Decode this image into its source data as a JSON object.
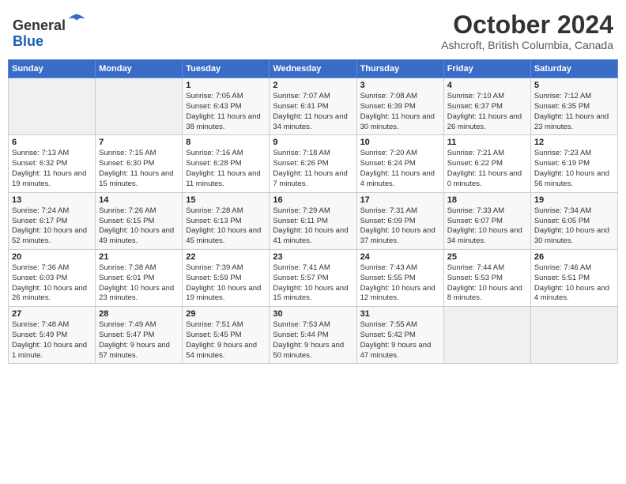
{
  "header": {
    "logo_line1": "General",
    "logo_line2": "Blue",
    "month": "October 2024",
    "location": "Ashcroft, British Columbia, Canada"
  },
  "weekdays": [
    "Sunday",
    "Monday",
    "Tuesday",
    "Wednesday",
    "Thursday",
    "Friday",
    "Saturday"
  ],
  "weeks": [
    [
      {
        "day": "",
        "sunrise": "",
        "sunset": "",
        "daylight": ""
      },
      {
        "day": "",
        "sunrise": "",
        "sunset": "",
        "daylight": ""
      },
      {
        "day": "1",
        "sunrise": "Sunrise: 7:05 AM",
        "sunset": "Sunset: 6:43 PM",
        "daylight": "Daylight: 11 hours and 38 minutes."
      },
      {
        "day": "2",
        "sunrise": "Sunrise: 7:07 AM",
        "sunset": "Sunset: 6:41 PM",
        "daylight": "Daylight: 11 hours and 34 minutes."
      },
      {
        "day": "3",
        "sunrise": "Sunrise: 7:08 AM",
        "sunset": "Sunset: 6:39 PM",
        "daylight": "Daylight: 11 hours and 30 minutes."
      },
      {
        "day": "4",
        "sunrise": "Sunrise: 7:10 AM",
        "sunset": "Sunset: 6:37 PM",
        "daylight": "Daylight: 11 hours and 26 minutes."
      },
      {
        "day": "5",
        "sunrise": "Sunrise: 7:12 AM",
        "sunset": "Sunset: 6:35 PM",
        "daylight": "Daylight: 11 hours and 23 minutes."
      }
    ],
    [
      {
        "day": "6",
        "sunrise": "Sunrise: 7:13 AM",
        "sunset": "Sunset: 6:32 PM",
        "daylight": "Daylight: 11 hours and 19 minutes."
      },
      {
        "day": "7",
        "sunrise": "Sunrise: 7:15 AM",
        "sunset": "Sunset: 6:30 PM",
        "daylight": "Daylight: 11 hours and 15 minutes."
      },
      {
        "day": "8",
        "sunrise": "Sunrise: 7:16 AM",
        "sunset": "Sunset: 6:28 PM",
        "daylight": "Daylight: 11 hours and 11 minutes."
      },
      {
        "day": "9",
        "sunrise": "Sunrise: 7:18 AM",
        "sunset": "Sunset: 6:26 PM",
        "daylight": "Daylight: 11 hours and 7 minutes."
      },
      {
        "day": "10",
        "sunrise": "Sunrise: 7:20 AM",
        "sunset": "Sunset: 6:24 PM",
        "daylight": "Daylight: 11 hours and 4 minutes."
      },
      {
        "day": "11",
        "sunrise": "Sunrise: 7:21 AM",
        "sunset": "Sunset: 6:22 PM",
        "daylight": "Daylight: 11 hours and 0 minutes."
      },
      {
        "day": "12",
        "sunrise": "Sunrise: 7:23 AM",
        "sunset": "Sunset: 6:19 PM",
        "daylight": "Daylight: 10 hours and 56 minutes."
      }
    ],
    [
      {
        "day": "13",
        "sunrise": "Sunrise: 7:24 AM",
        "sunset": "Sunset: 6:17 PM",
        "daylight": "Daylight: 10 hours and 52 minutes."
      },
      {
        "day": "14",
        "sunrise": "Sunrise: 7:26 AM",
        "sunset": "Sunset: 6:15 PM",
        "daylight": "Daylight: 10 hours and 49 minutes."
      },
      {
        "day": "15",
        "sunrise": "Sunrise: 7:28 AM",
        "sunset": "Sunset: 6:13 PM",
        "daylight": "Daylight: 10 hours and 45 minutes."
      },
      {
        "day": "16",
        "sunrise": "Sunrise: 7:29 AM",
        "sunset": "Sunset: 6:11 PM",
        "daylight": "Daylight: 10 hours and 41 minutes."
      },
      {
        "day": "17",
        "sunrise": "Sunrise: 7:31 AM",
        "sunset": "Sunset: 6:09 PM",
        "daylight": "Daylight: 10 hours and 37 minutes."
      },
      {
        "day": "18",
        "sunrise": "Sunrise: 7:33 AM",
        "sunset": "Sunset: 6:07 PM",
        "daylight": "Daylight: 10 hours and 34 minutes."
      },
      {
        "day": "19",
        "sunrise": "Sunrise: 7:34 AM",
        "sunset": "Sunset: 6:05 PM",
        "daylight": "Daylight: 10 hours and 30 minutes."
      }
    ],
    [
      {
        "day": "20",
        "sunrise": "Sunrise: 7:36 AM",
        "sunset": "Sunset: 6:03 PM",
        "daylight": "Daylight: 10 hours and 26 minutes."
      },
      {
        "day": "21",
        "sunrise": "Sunrise: 7:38 AM",
        "sunset": "Sunset: 6:01 PM",
        "daylight": "Daylight: 10 hours and 23 minutes."
      },
      {
        "day": "22",
        "sunrise": "Sunrise: 7:39 AM",
        "sunset": "Sunset: 5:59 PM",
        "daylight": "Daylight: 10 hours and 19 minutes."
      },
      {
        "day": "23",
        "sunrise": "Sunrise: 7:41 AM",
        "sunset": "Sunset: 5:57 PM",
        "daylight": "Daylight: 10 hours and 15 minutes."
      },
      {
        "day": "24",
        "sunrise": "Sunrise: 7:43 AM",
        "sunset": "Sunset: 5:55 PM",
        "daylight": "Daylight: 10 hours and 12 minutes."
      },
      {
        "day": "25",
        "sunrise": "Sunrise: 7:44 AM",
        "sunset": "Sunset: 5:53 PM",
        "daylight": "Daylight: 10 hours and 8 minutes."
      },
      {
        "day": "26",
        "sunrise": "Sunrise: 7:46 AM",
        "sunset": "Sunset: 5:51 PM",
        "daylight": "Daylight: 10 hours and 4 minutes."
      }
    ],
    [
      {
        "day": "27",
        "sunrise": "Sunrise: 7:48 AM",
        "sunset": "Sunset: 5:49 PM",
        "daylight": "Daylight: 10 hours and 1 minute."
      },
      {
        "day": "28",
        "sunrise": "Sunrise: 7:49 AM",
        "sunset": "Sunset: 5:47 PM",
        "daylight": "Daylight: 9 hours and 57 minutes."
      },
      {
        "day": "29",
        "sunrise": "Sunrise: 7:51 AM",
        "sunset": "Sunset: 5:45 PM",
        "daylight": "Daylight: 9 hours and 54 minutes."
      },
      {
        "day": "30",
        "sunrise": "Sunrise: 7:53 AM",
        "sunset": "Sunset: 5:44 PM",
        "daylight": "Daylight: 9 hours and 50 minutes."
      },
      {
        "day": "31",
        "sunrise": "Sunrise: 7:55 AM",
        "sunset": "Sunset: 5:42 PM",
        "daylight": "Daylight: 9 hours and 47 minutes."
      },
      {
        "day": "",
        "sunrise": "",
        "sunset": "",
        "daylight": ""
      },
      {
        "day": "",
        "sunrise": "",
        "sunset": "",
        "daylight": ""
      }
    ]
  ]
}
